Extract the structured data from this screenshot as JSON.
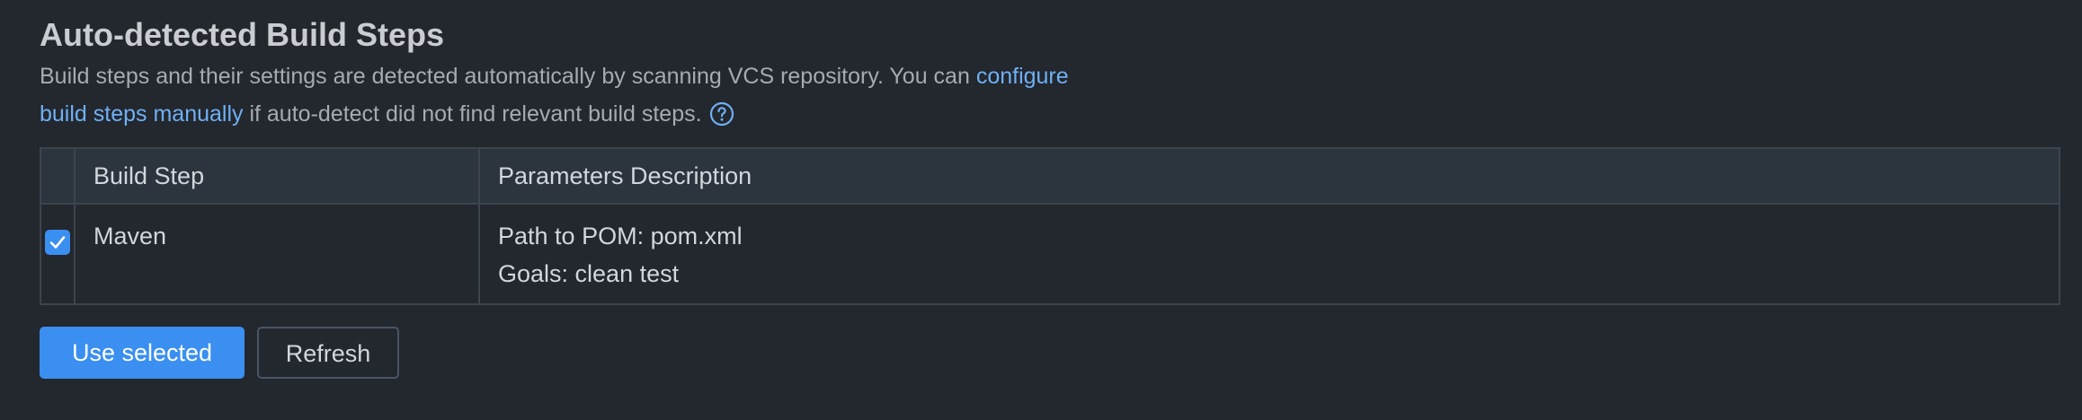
{
  "section": {
    "title": "Auto-detected Build Steps",
    "description_part1": "Build steps and their settings are detected automatically by scanning VCS repository. You can ",
    "configure_link": "configure",
    "manual_link": "build steps manually",
    "description_part2": " if auto-detect did not find relevant build steps.",
    "help_icon": "question-circle-icon"
  },
  "table": {
    "columns": [
      "",
      "Build Step",
      "Parameters Description"
    ],
    "rows": [
      {
        "checked": true,
        "build_step": "Maven",
        "parameters": [
          "Path to POM: pom.xml",
          "Goals: clean test"
        ]
      }
    ]
  },
  "buttons": {
    "use_selected": "Use selected",
    "refresh": "Refresh"
  },
  "colors": {
    "background": "#23272e",
    "accent": "#3a8ff0",
    "link": "#6fb0f3",
    "header_bg": "#2c343e",
    "border": "#3d444d"
  }
}
